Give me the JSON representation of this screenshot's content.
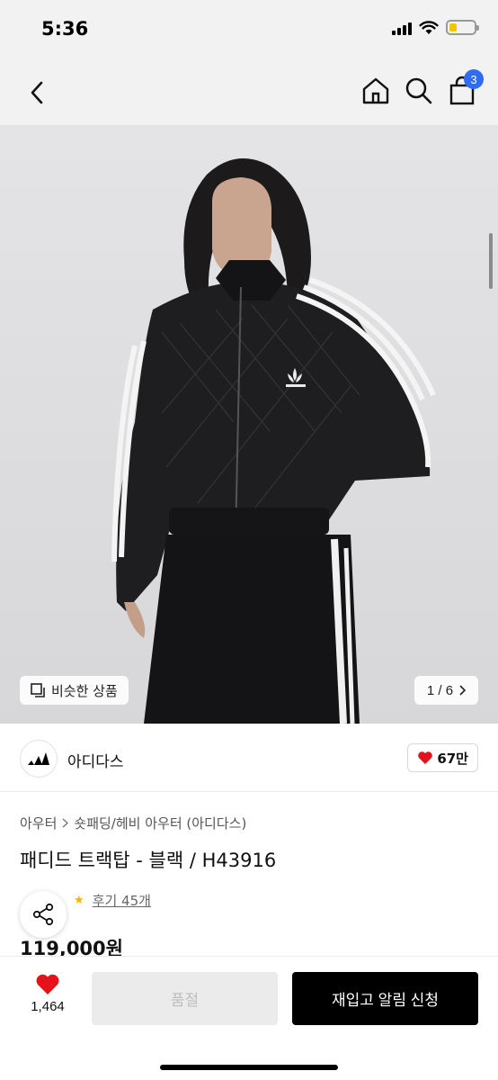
{
  "status_bar": {
    "time": "5:36"
  },
  "header": {
    "cart_count": "3"
  },
  "gallery": {
    "similar_label": "비슷한 상품",
    "pager_text": "1 / 6"
  },
  "brand": {
    "name": "아디다스",
    "like_count": "67만"
  },
  "product": {
    "breadcrumb": [
      "아우터",
      "숏패딩/헤비 아우터 (아디다스)"
    ],
    "title": "패디드 트랙탑 - 블랙 / H43916",
    "review_text": "후기 45개",
    "price": "119,000원"
  },
  "bottom_bar": {
    "wish_count": "1,464",
    "soldout_label": "품절",
    "restock_label": "재입고 알림 신청"
  },
  "colors": {
    "accent": "#2f6cf6",
    "heart": "#e6121b",
    "star": "#f5b400",
    "primary_button": "#000000",
    "disabled_button": "#ebebeb"
  }
}
